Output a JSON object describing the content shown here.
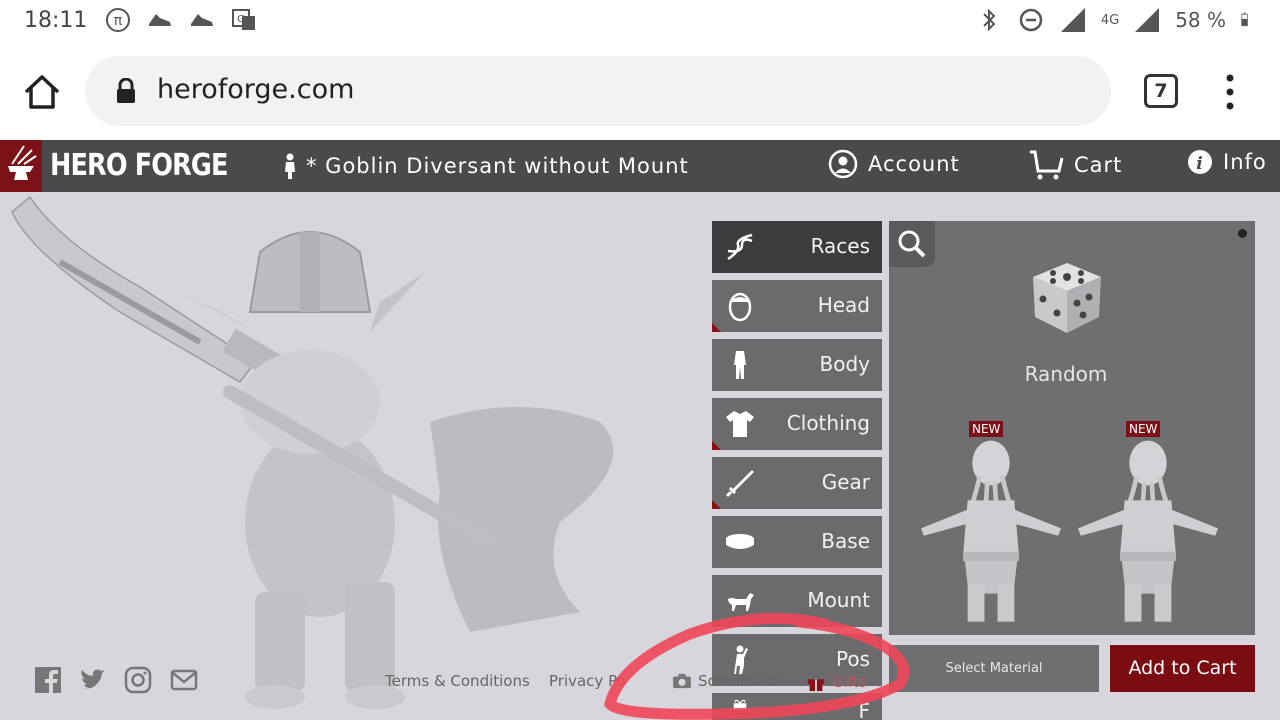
{
  "status_bar": {
    "time": "18:11",
    "network": "4G",
    "battery": "58 %"
  },
  "browser": {
    "url": "heroforge.com",
    "tab_count": "7"
  },
  "header": {
    "logo": "HERO FORGE",
    "title": "* Goblin Diversant without Mount",
    "nav": {
      "account": "Account",
      "cart": "Cart",
      "info": "Info"
    }
  },
  "categories": [
    {
      "label": "Races",
      "icon": "dna-icon",
      "active": true
    },
    {
      "label": "Head",
      "icon": "head-icon"
    },
    {
      "label": "Body",
      "icon": "body-icon"
    },
    {
      "label": "Clothing",
      "icon": "shirt-icon"
    },
    {
      "label": "Gear",
      "icon": "sword-icon"
    },
    {
      "label": "Base",
      "icon": "base-icon"
    },
    {
      "label": "Mount",
      "icon": "horse-icon"
    },
    {
      "label": "Pos",
      "icon": "pose-icon"
    },
    {
      "label": "F",
      "icon": "gift-icon"
    }
  ],
  "race_panel": {
    "random_label": "Random",
    "new_badge": "NEW"
  },
  "actions": {
    "select_material": "Select Material",
    "add_to_cart": "Add to Cart"
  },
  "footer": {
    "terms": "Terms & Conditions",
    "privacy": "Privacy Po",
    "screenshot": "Screenshot",
    "gifts": "Gifts"
  },
  "colors": {
    "header_bg": "#4a4a4c",
    "brand_red": "#7a1218",
    "main_bg": "#d6d6dc",
    "panel_bg": "#6f6f72",
    "active_cat": "#3c3c3e"
  }
}
